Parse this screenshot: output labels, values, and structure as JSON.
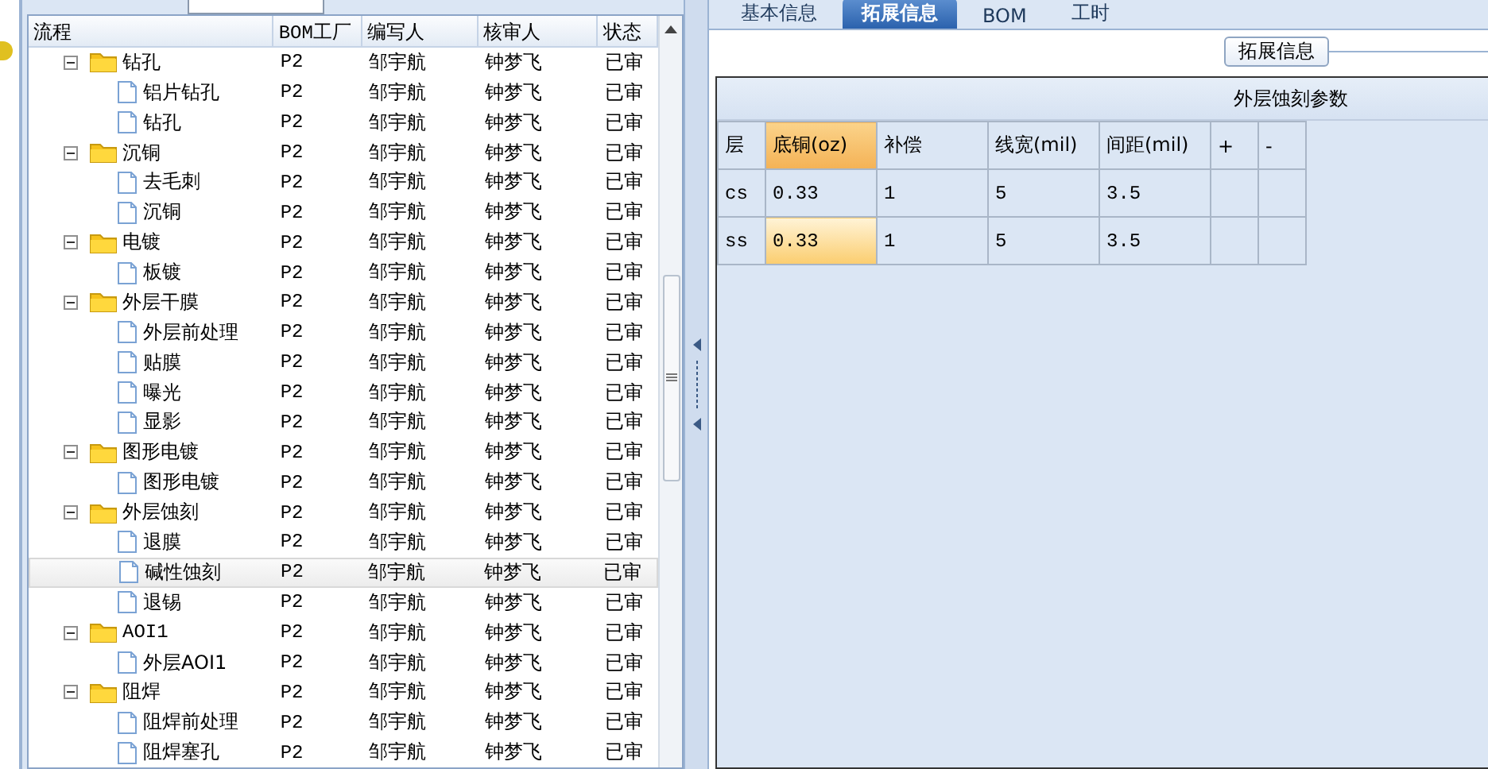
{
  "tree": {
    "columns": [
      "流程",
      "BOM工厂",
      "编写人",
      "核审人",
      "状态"
    ],
    "rows": [
      {
        "name": "钻孔",
        "factory": "P2",
        "author": "邹宇航",
        "reviewer": "钟梦飞",
        "status": "已审",
        "expanded": true,
        "selected": false,
        "children": [
          {
            "name": "铝片钻孔",
            "factory": "P2",
            "author": "邹宇航",
            "reviewer": "钟梦飞",
            "status": "已审",
            "selected": false
          },
          {
            "name": "钻孔",
            "factory": "P2",
            "author": "邹宇航",
            "reviewer": "钟梦飞",
            "status": "已审",
            "selected": false
          }
        ]
      },
      {
        "name": "沉铜",
        "factory": "P2",
        "author": "邹宇航",
        "reviewer": "钟梦飞",
        "status": "已审",
        "expanded": true,
        "selected": false,
        "children": [
          {
            "name": "去毛刺",
            "factory": "P2",
            "author": "邹宇航",
            "reviewer": "钟梦飞",
            "status": "已审",
            "selected": false
          },
          {
            "name": "沉铜",
            "factory": "P2",
            "author": "邹宇航",
            "reviewer": "钟梦飞",
            "status": "已审",
            "selected": false
          }
        ]
      },
      {
        "name": "电镀",
        "factory": "P2",
        "author": "邹宇航",
        "reviewer": "钟梦飞",
        "status": "已审",
        "expanded": true,
        "selected": false,
        "children": [
          {
            "name": "板镀",
            "factory": "P2",
            "author": "邹宇航",
            "reviewer": "钟梦飞",
            "status": "已审",
            "selected": false
          }
        ]
      },
      {
        "name": "外层干膜",
        "factory": "P2",
        "author": "邹宇航",
        "reviewer": "钟梦飞",
        "status": "已审",
        "expanded": true,
        "selected": false,
        "children": [
          {
            "name": "外层前处理",
            "factory": "P2",
            "author": "邹宇航",
            "reviewer": "钟梦飞",
            "status": "已审",
            "selected": false
          },
          {
            "name": "贴膜",
            "factory": "P2",
            "author": "邹宇航",
            "reviewer": "钟梦飞",
            "status": "已审",
            "selected": false
          },
          {
            "name": "曝光",
            "factory": "P2",
            "author": "邹宇航",
            "reviewer": "钟梦飞",
            "status": "已审",
            "selected": false
          },
          {
            "name": "显影",
            "factory": "P2",
            "author": "邹宇航",
            "reviewer": "钟梦飞",
            "status": "已审",
            "selected": false
          }
        ]
      },
      {
        "name": "图形电镀",
        "factory": "P2",
        "author": "邹宇航",
        "reviewer": "钟梦飞",
        "status": "已审",
        "expanded": true,
        "selected": false,
        "children": [
          {
            "name": "图形电镀",
            "factory": "P2",
            "author": "邹宇航",
            "reviewer": "钟梦飞",
            "status": "已审",
            "selected": false
          }
        ]
      },
      {
        "name": "外层蚀刻",
        "factory": "P2",
        "author": "邹宇航",
        "reviewer": "钟梦飞",
        "status": "已审",
        "expanded": true,
        "selected": false,
        "children": [
          {
            "name": "退膜",
            "factory": "P2",
            "author": "邹宇航",
            "reviewer": "钟梦飞",
            "status": "已审",
            "selected": false
          },
          {
            "name": "碱性蚀刻",
            "factory": "P2",
            "author": "邹宇航",
            "reviewer": "钟梦飞",
            "status": "已审",
            "selected": true
          },
          {
            "name": "退锡",
            "factory": "P2",
            "author": "邹宇航",
            "reviewer": "钟梦飞",
            "status": "已审",
            "selected": false
          }
        ]
      },
      {
        "name": "AOI1",
        "factory": "P2",
        "author": "邹宇航",
        "reviewer": "钟梦飞",
        "status": "已审",
        "expanded": true,
        "selected": false,
        "children": [
          {
            "name": "外层AOI1",
            "factory": "P2",
            "author": "邹宇航",
            "reviewer": "钟梦飞",
            "status": "已审",
            "selected": false
          }
        ]
      },
      {
        "name": "阻焊",
        "factory": "P2",
        "author": "邹宇航",
        "reviewer": "钟梦飞",
        "status": "已审",
        "expanded": true,
        "selected": false,
        "children": [
          {
            "name": "阻焊前处理",
            "factory": "P2",
            "author": "邹宇航",
            "reviewer": "钟梦飞",
            "status": "已审",
            "selected": false
          },
          {
            "name": "阻焊塞孔",
            "factory": "P2",
            "author": "邹宇航",
            "reviewer": "钟梦飞",
            "status": "已审",
            "selected": false
          }
        ]
      }
    ]
  },
  "tabs": [
    {
      "label": "基本信息",
      "selected": false
    },
    {
      "label": "拓展信息",
      "selected": true
    },
    {
      "label": "BOM",
      "selected": false
    },
    {
      "label": "工时",
      "selected": false
    }
  ],
  "group_box": {
    "title": "拓展信息"
  },
  "params": {
    "title": "外层蚀刻参数",
    "columns": [
      {
        "label": "层",
        "selected": false
      },
      {
        "label": "底铜(oz)",
        "selected": true
      },
      {
        "label": "补偿",
        "selected": false
      },
      {
        "label": "线宽(mil)",
        "selected": false
      },
      {
        "label": "间距(mil)",
        "selected": false
      },
      {
        "label": "+",
        "selected": false
      },
      {
        "label": "-",
        "selected": false
      }
    ],
    "rows": [
      {
        "cells": [
          "cs",
          "0.33",
          "1",
          "5",
          "3.5"
        ],
        "selected": false
      },
      {
        "cells": [
          "ss",
          "0.33",
          "1",
          "5",
          "3.5"
        ],
        "selected": true
      }
    ]
  }
}
